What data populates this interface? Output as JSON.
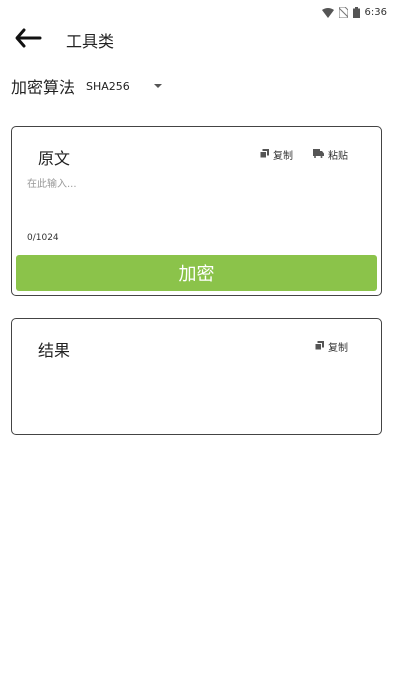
{
  "status_bar": {
    "time": "6:36",
    "icons": [
      "wifi-icon",
      "no-sim-icon",
      "battery-icon"
    ]
  },
  "app_bar": {
    "back_icon": "back-arrow-icon",
    "title": "工具类"
  },
  "algorithm": {
    "label": "加密算法",
    "selected": "SHA256"
  },
  "input_card": {
    "title": "原文",
    "copy_label": "复制",
    "paste_label": "粘贴",
    "placeholder": "在此输入...",
    "value": "",
    "char_count": "0/1024",
    "encrypt_label": "加密"
  },
  "result_card": {
    "title": "结果",
    "copy_label": "复制"
  },
  "colors": {
    "accent": "#8bc34a",
    "card_border": "#444444"
  }
}
